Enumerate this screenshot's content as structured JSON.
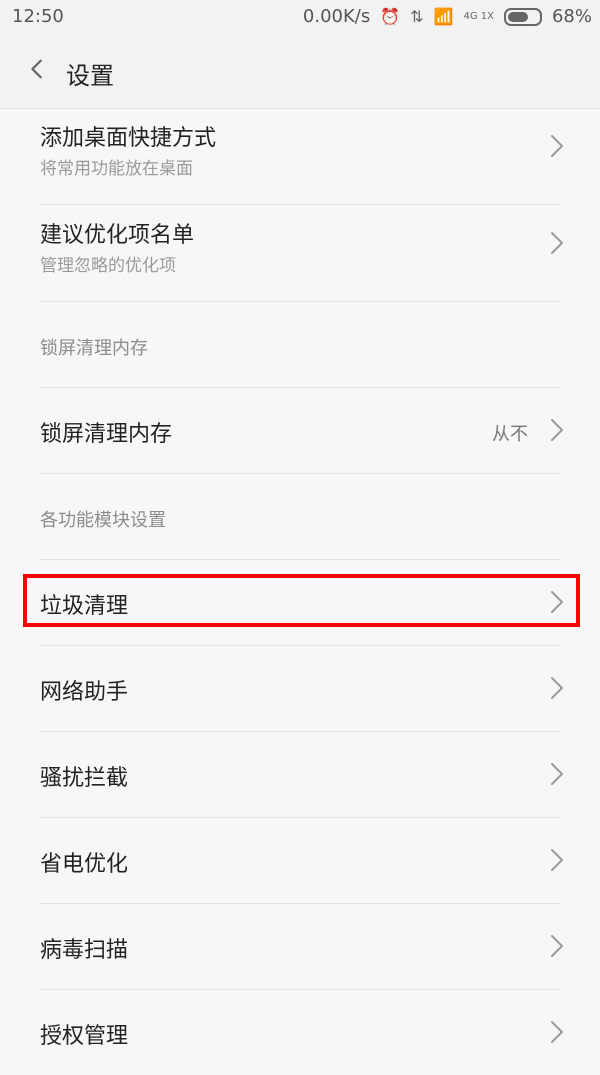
{
  "status_bar": {
    "time": "12:50",
    "speed": "0.00K/s",
    "battery_percent": "68%",
    "battery_level": 0.68,
    "network": "4G 1X",
    "icons": [
      "alarm-icon",
      "data-sync-icon",
      "signal-icon",
      "battery-icon"
    ]
  },
  "header": {
    "title": "设置"
  },
  "items_top": [
    {
      "label": "添加桌面快捷方式",
      "sub": "将常用功能放在桌面"
    },
    {
      "label": "建议优化项名单",
      "sub": "管理忽略的优化项"
    }
  ],
  "section_lock": {
    "title": "锁屏清理内存"
  },
  "lock_item": {
    "label": "锁屏清理内存",
    "value": "从不"
  },
  "section_modules": {
    "title": "各功能模块设置"
  },
  "modules": [
    {
      "label": "垃圾清理"
    },
    {
      "label": "网络助手"
    },
    {
      "label": "骚扰拦截"
    },
    {
      "label": "省电优化"
    },
    {
      "label": "病毒扫描"
    },
    {
      "label": "授权管理"
    }
  ],
  "colors": {
    "highlight": "#ff0000",
    "background": "#f7f7f7"
  }
}
